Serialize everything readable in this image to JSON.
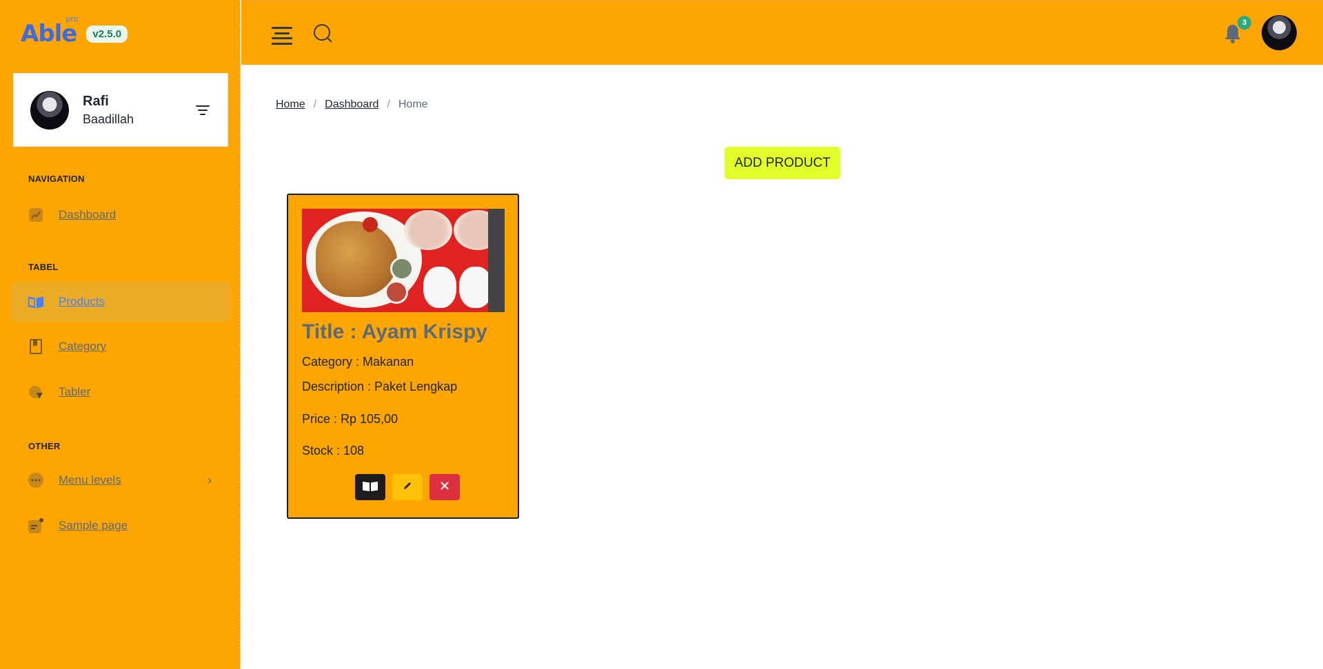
{
  "brand": {
    "name": "Able",
    "tag": "pro",
    "version": "v2.5.0"
  },
  "user": {
    "first_name": "Rafi",
    "last_name": "Baadillah"
  },
  "sidebar": {
    "captions": [
      "NAVIGATION",
      "TABEL",
      "OTHER"
    ],
    "items": [
      {
        "label": " Dashboard",
        "icon": "chart-icon",
        "active": false
      },
      {
        "label": "Products",
        "icon": "book-open-icon",
        "active": true
      },
      {
        "label": "Category",
        "icon": "book-icon",
        "active": false
      },
      {
        "label": "Tabler",
        "icon": "pie-chart-icon",
        "active": false
      },
      {
        "label": "Menu levels",
        "icon": "dots-circle-icon",
        "active": false,
        "has_submenu": true
      },
      {
        "label": " Sample page",
        "icon": "document-icon",
        "active": false
      }
    ]
  },
  "header": {
    "notification_count": "3"
  },
  "breadcrumb": {
    "items": [
      "Home",
      "Dashboard"
    ],
    "current": "Home"
  },
  "main": {
    "add_button_label": "ADD PRODUCT"
  },
  "product": {
    "title": "Title : Ayam Krispy",
    "category": "Category : Makanan",
    "description": "Description : Paket Lengkap",
    "price": "Price : Rp 105,00",
    "stock": "Stock : 108"
  },
  "colors": {
    "primary_orange": "#ffa500",
    "active_item": "#ecac25",
    "add_button": "#e3ff2b",
    "accent_blue": "#4680ff",
    "badge_green": "#2ca87f",
    "delete_red": "#dc2f3f",
    "edit_yellow": "#ffc107"
  }
}
